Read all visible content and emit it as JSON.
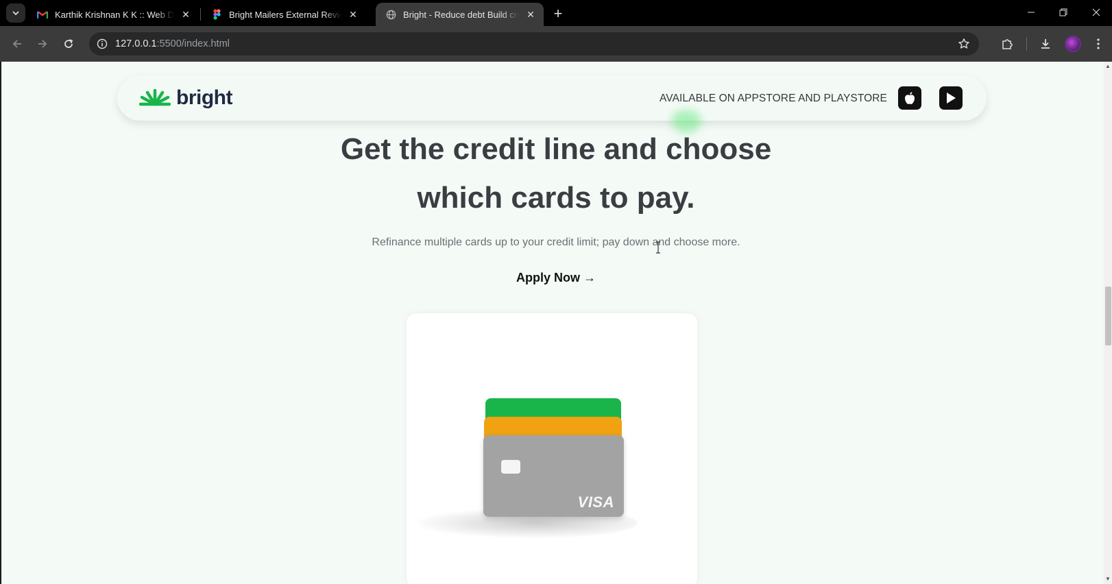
{
  "browser": {
    "tabs": [
      {
        "title": "Karthik Krishnan K K :: Web Dev",
        "favicon": "gmail-icon",
        "active": false
      },
      {
        "title": "Bright Mailers External Review –",
        "favicon": "figma-icon",
        "active": false
      },
      {
        "title": "Bright - Reduce debt Build cred",
        "favicon": "globe-icon",
        "active": true
      }
    ],
    "url_host": "127.0.0.1",
    "url_rest": ":5500/index.html"
  },
  "page": {
    "brand": "bright",
    "availability": "AVAILABLE ON APPSTORE AND PLAYSTORE",
    "headline_line1": "Get the credit line and choose",
    "headline_line2": "which cards to pay.",
    "subtitle": "Refinance multiple cards up to your credit limit; pay down and choose more.",
    "cta": "Apply Now →",
    "card_brand": "VISA",
    "colors": {
      "brand_green": "#19b54a",
      "card_green": "#19b54a",
      "card_orange": "#f0a211",
      "card_grey": "#a3a3a3",
      "headline": "#3a3d41"
    }
  }
}
